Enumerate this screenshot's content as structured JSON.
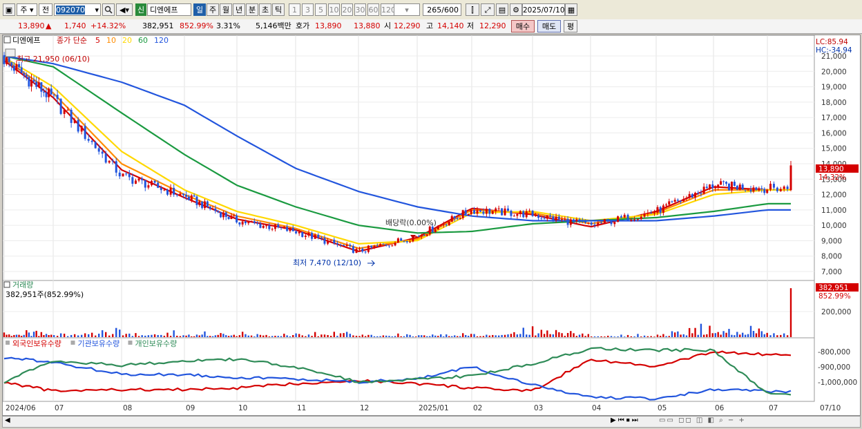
{
  "toolbar": {
    "market": "주",
    "compare": "전",
    "code": "092070",
    "credit": "신",
    "name": "디엔에프",
    "periods": [
      "일",
      "주",
      "월",
      "년",
      "분",
      "초",
      "틱"
    ],
    "active_period": "일",
    "minutes": [
      "1",
      "3",
      "5",
      "10",
      "20",
      "30",
      "60",
      "120"
    ],
    "count_value": "265",
    "count_total": "/600",
    "date": "2025/07/10"
  },
  "quote": {
    "price": "13,890",
    "arrow": "▲",
    "change": "1,740",
    "change_pct": "+14.32%",
    "volume": "382,951",
    "volume_pct": "852.99%",
    "turnover_pct": "3.31%",
    "amount": "5,146백만",
    "bid_label": "호가",
    "ask": "13,890",
    "bid": "13,880",
    "open_label": "시",
    "open": "12,290",
    "high_label": "고",
    "high": "14,140",
    "low_label": "저",
    "low": "12,290",
    "buy_button": "매수",
    "sell_button": "매도",
    "eval_button": "평"
  },
  "price_panel": {
    "title": "디엔에프",
    "ma_label": "종가 단순",
    "ma_periods": [
      "5",
      "10",
      "20",
      "60",
      "120"
    ],
    "ma_colors": [
      "#d40000",
      "#ff8c00",
      "#ffd800",
      "#1a9a40",
      "#2255dd"
    ],
    "lc_label": "LC:85.94",
    "hc_label": "HC:-34.94",
    "high_annotation": "최고 21,950 (06/10)",
    "low_annotation": "최저 7,470 (12/10)",
    "dividend_annotation": "배당락(0.00%)",
    "y_ticks": [
      "21,000",
      "20,000",
      "19,000",
      "18,000",
      "17,000",
      "16,000",
      "15,000",
      "14,000",
      "13,000",
      "12,000",
      "11,000",
      "10,000",
      "9,000",
      "8,000",
      "7,000"
    ],
    "last_price_tag": "13,890",
    "last_change_tag": "14.32%"
  },
  "volume_panel": {
    "title": "거래량",
    "value_label": "382,951주(852.99%)",
    "y_ticks": [
      "200,000"
    ],
    "last_volume_tag": "382,951",
    "last_pct_tag": "852.99%"
  },
  "holdings_panel": {
    "series": [
      "외국인보유수량",
      "기관보유수량",
      "개인보유수량"
    ],
    "colors": [
      "#d40000",
      "#2255dd",
      "#2e8b57"
    ],
    "y_ticks": [
      "-800,000",
      "-900,000",
      "-1,000,000"
    ]
  },
  "x_axis": {
    "labels": [
      "2024/06",
      "07",
      "08",
      "09",
      "10",
      "11",
      "12",
      "2025/01",
      "02",
      "03",
      "04",
      "05",
      "06",
      "07",
      "07/10"
    ]
  },
  "chart_data": [
    {
      "type": "candlestick",
      "title": "디엔에프",
      "x": [
        "2024/06",
        "07",
        "08",
        "09",
        "10",
        "11",
        "12",
        "2025/01",
        "02",
        "03",
        "04",
        "05",
        "06",
        "07"
      ],
      "close_monthly_approx": [
        20800,
        18200,
        13200,
        11900,
        10300,
        9600,
        8300,
        9300,
        11000,
        10700,
        10000,
        10900,
        12600,
        12400
      ],
      "last_close": 13890,
      "period_high": 21950,
      "period_high_date": "06/10",
      "period_low": 7470,
      "period_low_date": "12/10",
      "ylim": [
        7000,
        21500
      ],
      "moving_averages": [
        {
          "name": "5",
          "values": [
            20700,
            18300,
            13600,
            11800,
            10400,
            9700,
            8300,
            9200,
            11100,
            10700,
            9900,
            10900,
            12500,
            12300
          ]
        },
        {
          "name": "10",
          "values": [
            20800,
            18600,
            14000,
            12000,
            10600,
            9800,
            8500,
            9100,
            11000,
            10800,
            10100,
            10800,
            12300,
            12300
          ]
        },
        {
          "name": "20",
          "values": [
            20900,
            19000,
            14800,
            12300,
            10900,
            10000,
            8800,
            9000,
            10800,
            10900,
            10300,
            10700,
            12000,
            12300
          ]
        },
        {
          "name": "60",
          "values": [
            21000,
            20300,
            17300,
            14600,
            12600,
            11200,
            10000,
            9500,
            9600,
            10100,
            10300,
            10500,
            10900,
            11400
          ]
        },
        {
          "name": "120",
          "values": [
            21000,
            20500,
            19300,
            17800,
            15800,
            13700,
            12200,
            11200,
            10600,
            10300,
            10300,
            10300,
            10600,
            11000
          ]
        }
      ]
    },
    {
      "type": "bar",
      "title": "거래량",
      "x": [
        "2024/06",
        "07",
        "08",
        "09",
        "10",
        "11",
        "12",
        "2025/01",
        "02",
        "03",
        "04",
        "05",
        "06",
        "07"
      ],
      "values_monthly_peak_approx": [
        70000,
        60000,
        75000,
        50000,
        45000,
        40000,
        55000,
        35000,
        45000,
        110000,
        40000,
        30000,
        130000,
        120000
      ],
      "last_volume": 382951
    },
    {
      "type": "line",
      "x": [
        "2024/06",
        "07",
        "08",
        "09",
        "10",
        "11",
        "12",
        "2025/01",
        "02",
        "03",
        "04",
        "05",
        "06",
        "07"
      ],
      "series": [
        {
          "name": "외국인보유수량",
          "values": [
            -1000000,
            -1060000,
            -1050000,
            -1050000,
            -1040000,
            -1010000,
            -990000,
            -1010000,
            -1040000,
            -1060000,
            -850000,
            -900000,
            -800000,
            -820000
          ]
        },
        {
          "name": "기관보유수량",
          "values": [
            -840000,
            -870000,
            -950000,
            -950000,
            -970000,
            -980000,
            -1000000,
            -980000,
            -900000,
            -1020000,
            -1100000,
            -1110000,
            -1050000,
            -1060000
          ]
        },
        {
          "name": "개인보유수량",
          "values": [
            -1000000,
            -860000,
            -890000,
            -860000,
            -850000,
            -900000,
            -1000000,
            -980000,
            -960000,
            -880000,
            -780000,
            -790000,
            -790000,
            -1080000
          ]
        }
      ]
    }
  ]
}
